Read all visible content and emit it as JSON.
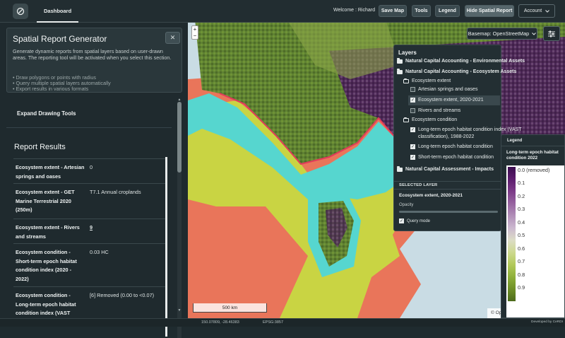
{
  "header": {
    "tab": "Dashboard",
    "welcome": "Welcome : Richard",
    "buttons": [
      "Save Map",
      "Tools",
      "Legend",
      "Hide Spatial Report"
    ],
    "account": "Account"
  },
  "sidebar": {
    "generator_title": "Spatial Report Generator",
    "generator_desc": "Generate dynamic reports from spatial layers based on user-drawn areas. The reporting tool will be activated when you select this section.",
    "bullets": [
      "• Draw polygons or points with radius",
      "• Query multiple spatial layers automatically",
      "• Export results in various formats"
    ],
    "close": "✕",
    "expand": "Expand Drawing Tools",
    "results_title": "Report Results",
    "results": [
      {
        "key": "Ecosystem extent - Artesian springs and oases",
        "value": "0"
      },
      {
        "key": "Ecosystem extent - GET Marine Terrestrial 2020 (250m)",
        "value": "T7.1 Annual croplands"
      },
      {
        "key": "Ecosystem extent - Rivers and streams",
        "value": "9"
      },
      {
        "key": "Ecosystem condition - Short-term epoch habitat condition index (2020 - 2022)",
        "value": "0.03 HC"
      },
      {
        "key": "Ecosystem condition - Long-term epoch habitat condition index (VAST",
        "value": "[6] Removed (0.00 to <0.07)"
      }
    ]
  },
  "map": {
    "zoom_in": "+",
    "zoom_out": "−",
    "scale": "500 km",
    "attribution": "© OpenStreetMap contributors.",
    "basemap": "Basemap: OpenStreetMap"
  },
  "layers": {
    "title": "Layers",
    "groups": [
      {
        "label": "Natural Capital Accounting - Environmental Assets"
      },
      {
        "label": "Natural Capital Accounting - Ecosystem Assets"
      }
    ],
    "sub1": "Ecosystem extent",
    "items1": [
      {
        "label": "Artesian springs and oases",
        "checked": false
      },
      {
        "label": "Ecosystem extent, 2020-2021",
        "checked": true
      },
      {
        "label": "Rivers and streams",
        "checked": false
      }
    ],
    "sub2": "Ecosystem condition",
    "items2": [
      {
        "label": "Long-term epoch habitat condition index (VAST",
        "label2": "classification), 1988-2022",
        "checked": true
      },
      {
        "label": "Long-term epoch habitat condition",
        "checked": true
      },
      {
        "label": "Short-term epoch habitat condition",
        "checked": true
      }
    ],
    "group3": "Natural Capital Assessment - Impacts",
    "selected_header": "SELECTED LAYER",
    "selected_name": "Ecosystem extent, 2020-2021",
    "opacity": "Opacity",
    "query_mode": "Query mode"
  },
  "legend": {
    "title": "Legend",
    "subtitle": "Long-term epoch habitat condition 2022",
    "labels": [
      "0.0 (removed)",
      "0.1",
      "0.2",
      "0.3",
      "0.4",
      "0.5",
      "0.6",
      "0.7",
      "0.8",
      "0.9"
    ]
  },
  "status": {
    "coords": "150.07809, -28.46383",
    "epsg": "EPSG:3857",
    "credit": "Developed by CeRDI"
  }
}
